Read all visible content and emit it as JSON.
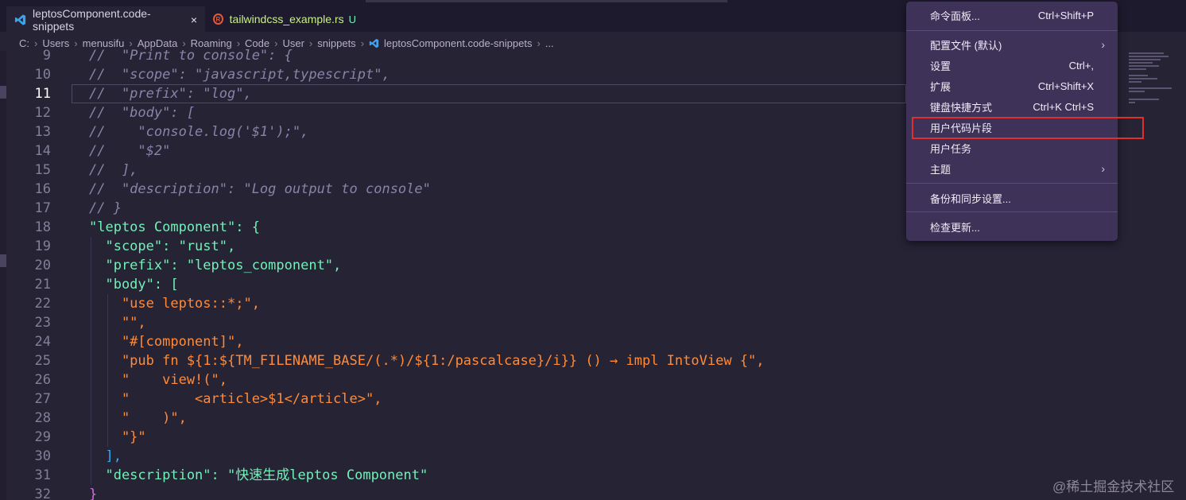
{
  "tabs": [
    {
      "label": "leptosComponent.code-snippets",
      "close": "×"
    },
    {
      "label": "tailwindcss_example.rs",
      "badge": "U"
    }
  ],
  "breadcrumb": [
    "C:",
    "Users",
    "menusifu",
    "AppData",
    "Roaming",
    "Code",
    "User",
    "snippets",
    "leptosComponent.code-snippets",
    "..."
  ],
  "editor": {
    "current_line": 11,
    "lines": [
      {
        "n": "9",
        "t": "//  \"Print to console\": {"
      },
      {
        "n": "10",
        "t": "//  \"scope\": \"javascript,typescript\","
      },
      {
        "n": "11",
        "t": "//  \"prefix\": \"log\","
      },
      {
        "n": "12",
        "t": "//  \"body\": ["
      },
      {
        "n": "13",
        "t": "//    \"console.log('$1');\","
      },
      {
        "n": "14",
        "t": "//    \"$2\""
      },
      {
        "n": "15",
        "t": "//  ],"
      },
      {
        "n": "16",
        "t": "//  \"description\": \"Log output to console\""
      },
      {
        "n": "17",
        "t": "// }"
      },
      {
        "n": "18",
        "t": "\"leptos Component\": {"
      },
      {
        "n": "19",
        "t": "  \"scope\": \"rust\","
      },
      {
        "n": "20",
        "t": "  \"prefix\": \"leptos_component\","
      },
      {
        "n": "21",
        "t": "  \"body\": ["
      },
      {
        "n": "22",
        "t": "    \"use leptos::*;\","
      },
      {
        "n": "23",
        "t": "    \"\","
      },
      {
        "n": "24",
        "t": "    \"#[component]\","
      },
      {
        "n": "25",
        "t": "    \"pub fn ${1:${TM_FILENAME_BASE/(.*)/${1:/pascalcase}/i}} () → impl IntoView {\","
      },
      {
        "n": "26",
        "t": "    \"    view!(\","
      },
      {
        "n": "27",
        "t": "    \"        <article>$1</article>\","
      },
      {
        "n": "28",
        "t": "    \"    )\","
      },
      {
        "n": "29",
        "t": "    \"}\""
      },
      {
        "n": "30",
        "t": "  ],"
      },
      {
        "n": "31",
        "t": "  \"description\": \"快速生成leptos Component\""
      },
      {
        "n": "32",
        "t": "}"
      }
    ]
  },
  "menu": {
    "items": [
      {
        "label": "命令面板...",
        "shortcut": "Ctrl+Shift+P"
      },
      {
        "label": "配置文件 (默认)",
        "submenu": true
      },
      {
        "label": "设置",
        "shortcut": "Ctrl+,"
      },
      {
        "label": "扩展",
        "shortcut": "Ctrl+Shift+X"
      },
      {
        "label": "键盘快捷方式",
        "shortcut": "Ctrl+K Ctrl+S"
      },
      {
        "label": "用户代码片段",
        "highlighted": true
      },
      {
        "label": "用户任务"
      },
      {
        "label": "主题",
        "submenu": true
      },
      {
        "label": "备份和同步设置..."
      },
      {
        "label": "检查更新..."
      }
    ]
  },
  "watermark": "@稀土掘金技术社区",
  "colors": {
    "background": "#262335",
    "menu_bg": "#3f3259",
    "highlight_border": "#e0302e",
    "string": "#ff8b39",
    "key": "#72f1b8",
    "comment": "#8a83a8"
  }
}
